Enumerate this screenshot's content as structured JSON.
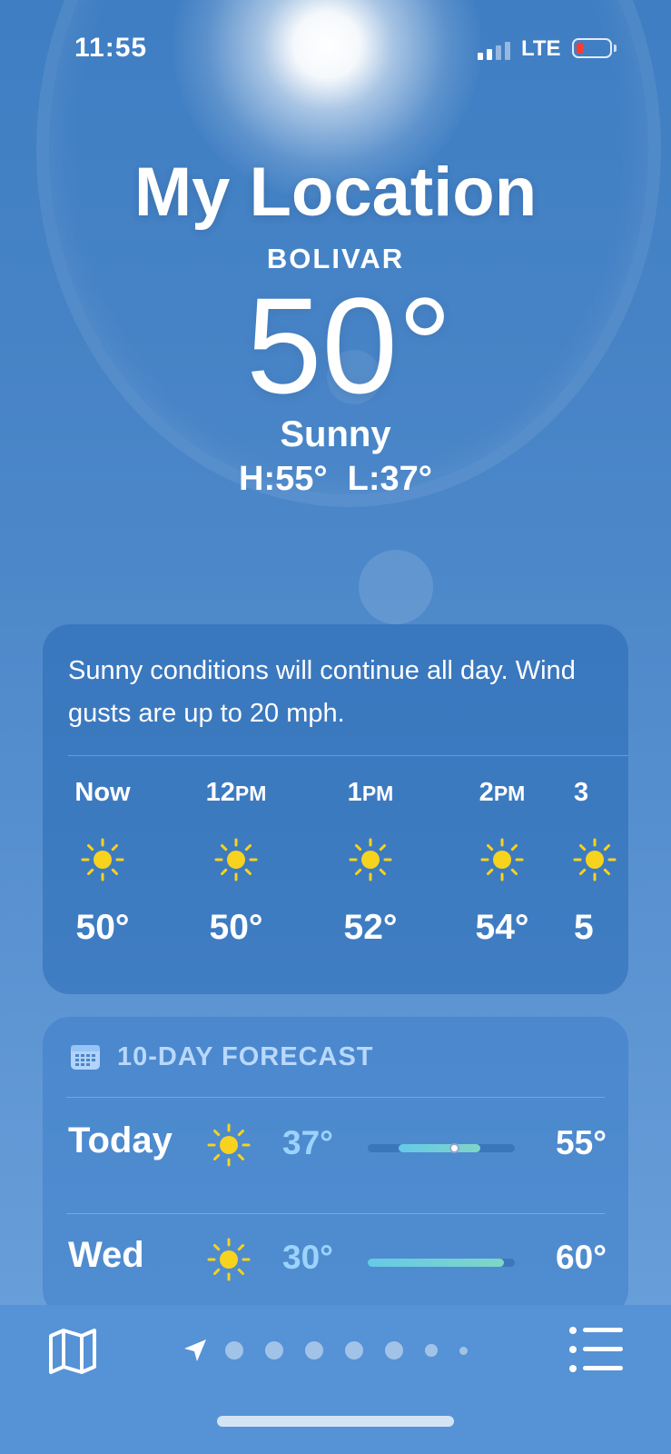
{
  "status_bar": {
    "time": "11:55",
    "network": "LTE",
    "battery_color": "#ff3b30"
  },
  "header": {
    "title": "My Location",
    "subtitle": "BOLIVAR",
    "temperature": "50°",
    "condition": "Sunny",
    "high": "H:55°",
    "low": "L:37°"
  },
  "hourly": {
    "summary": "Sunny conditions will continue all day. Wind gusts are up to 20 mph.",
    "items": [
      {
        "time": "Now",
        "suffix": "",
        "icon": "sun-icon",
        "temp": "50°"
      },
      {
        "time": "12",
        "suffix": "PM",
        "icon": "sun-icon",
        "temp": "50°"
      },
      {
        "time": "1",
        "suffix": "PM",
        "icon": "sun-icon",
        "temp": "52°"
      },
      {
        "time": "2",
        "suffix": "PM",
        "icon": "sun-icon",
        "temp": "54°"
      },
      {
        "time": "3",
        "suffix": "",
        "icon": "sun-icon",
        "temp": "5"
      }
    ]
  },
  "forecast": {
    "title": "10-DAY FORECAST",
    "icon": "calendar-icon",
    "days": [
      {
        "day": "Today",
        "icon": "sun-icon",
        "low": "37°",
        "high": "55°",
        "current_marker": true
      },
      {
        "day": "Wed",
        "icon": "sun-icon",
        "low": "30°",
        "high": "60°",
        "current_marker": false
      }
    ]
  },
  "toolbar": {
    "left_icon": "map-icon",
    "location_icon": "location-arrow-icon",
    "page_count": 7,
    "right_icon": "list-icon"
  },
  "colors": {
    "sun": "#f7d31e",
    "accent_low_temp": "#a0d7ff",
    "bar_gradient_start": "#66c9e8",
    "bar_gradient_end": "#7ed6c6"
  }
}
